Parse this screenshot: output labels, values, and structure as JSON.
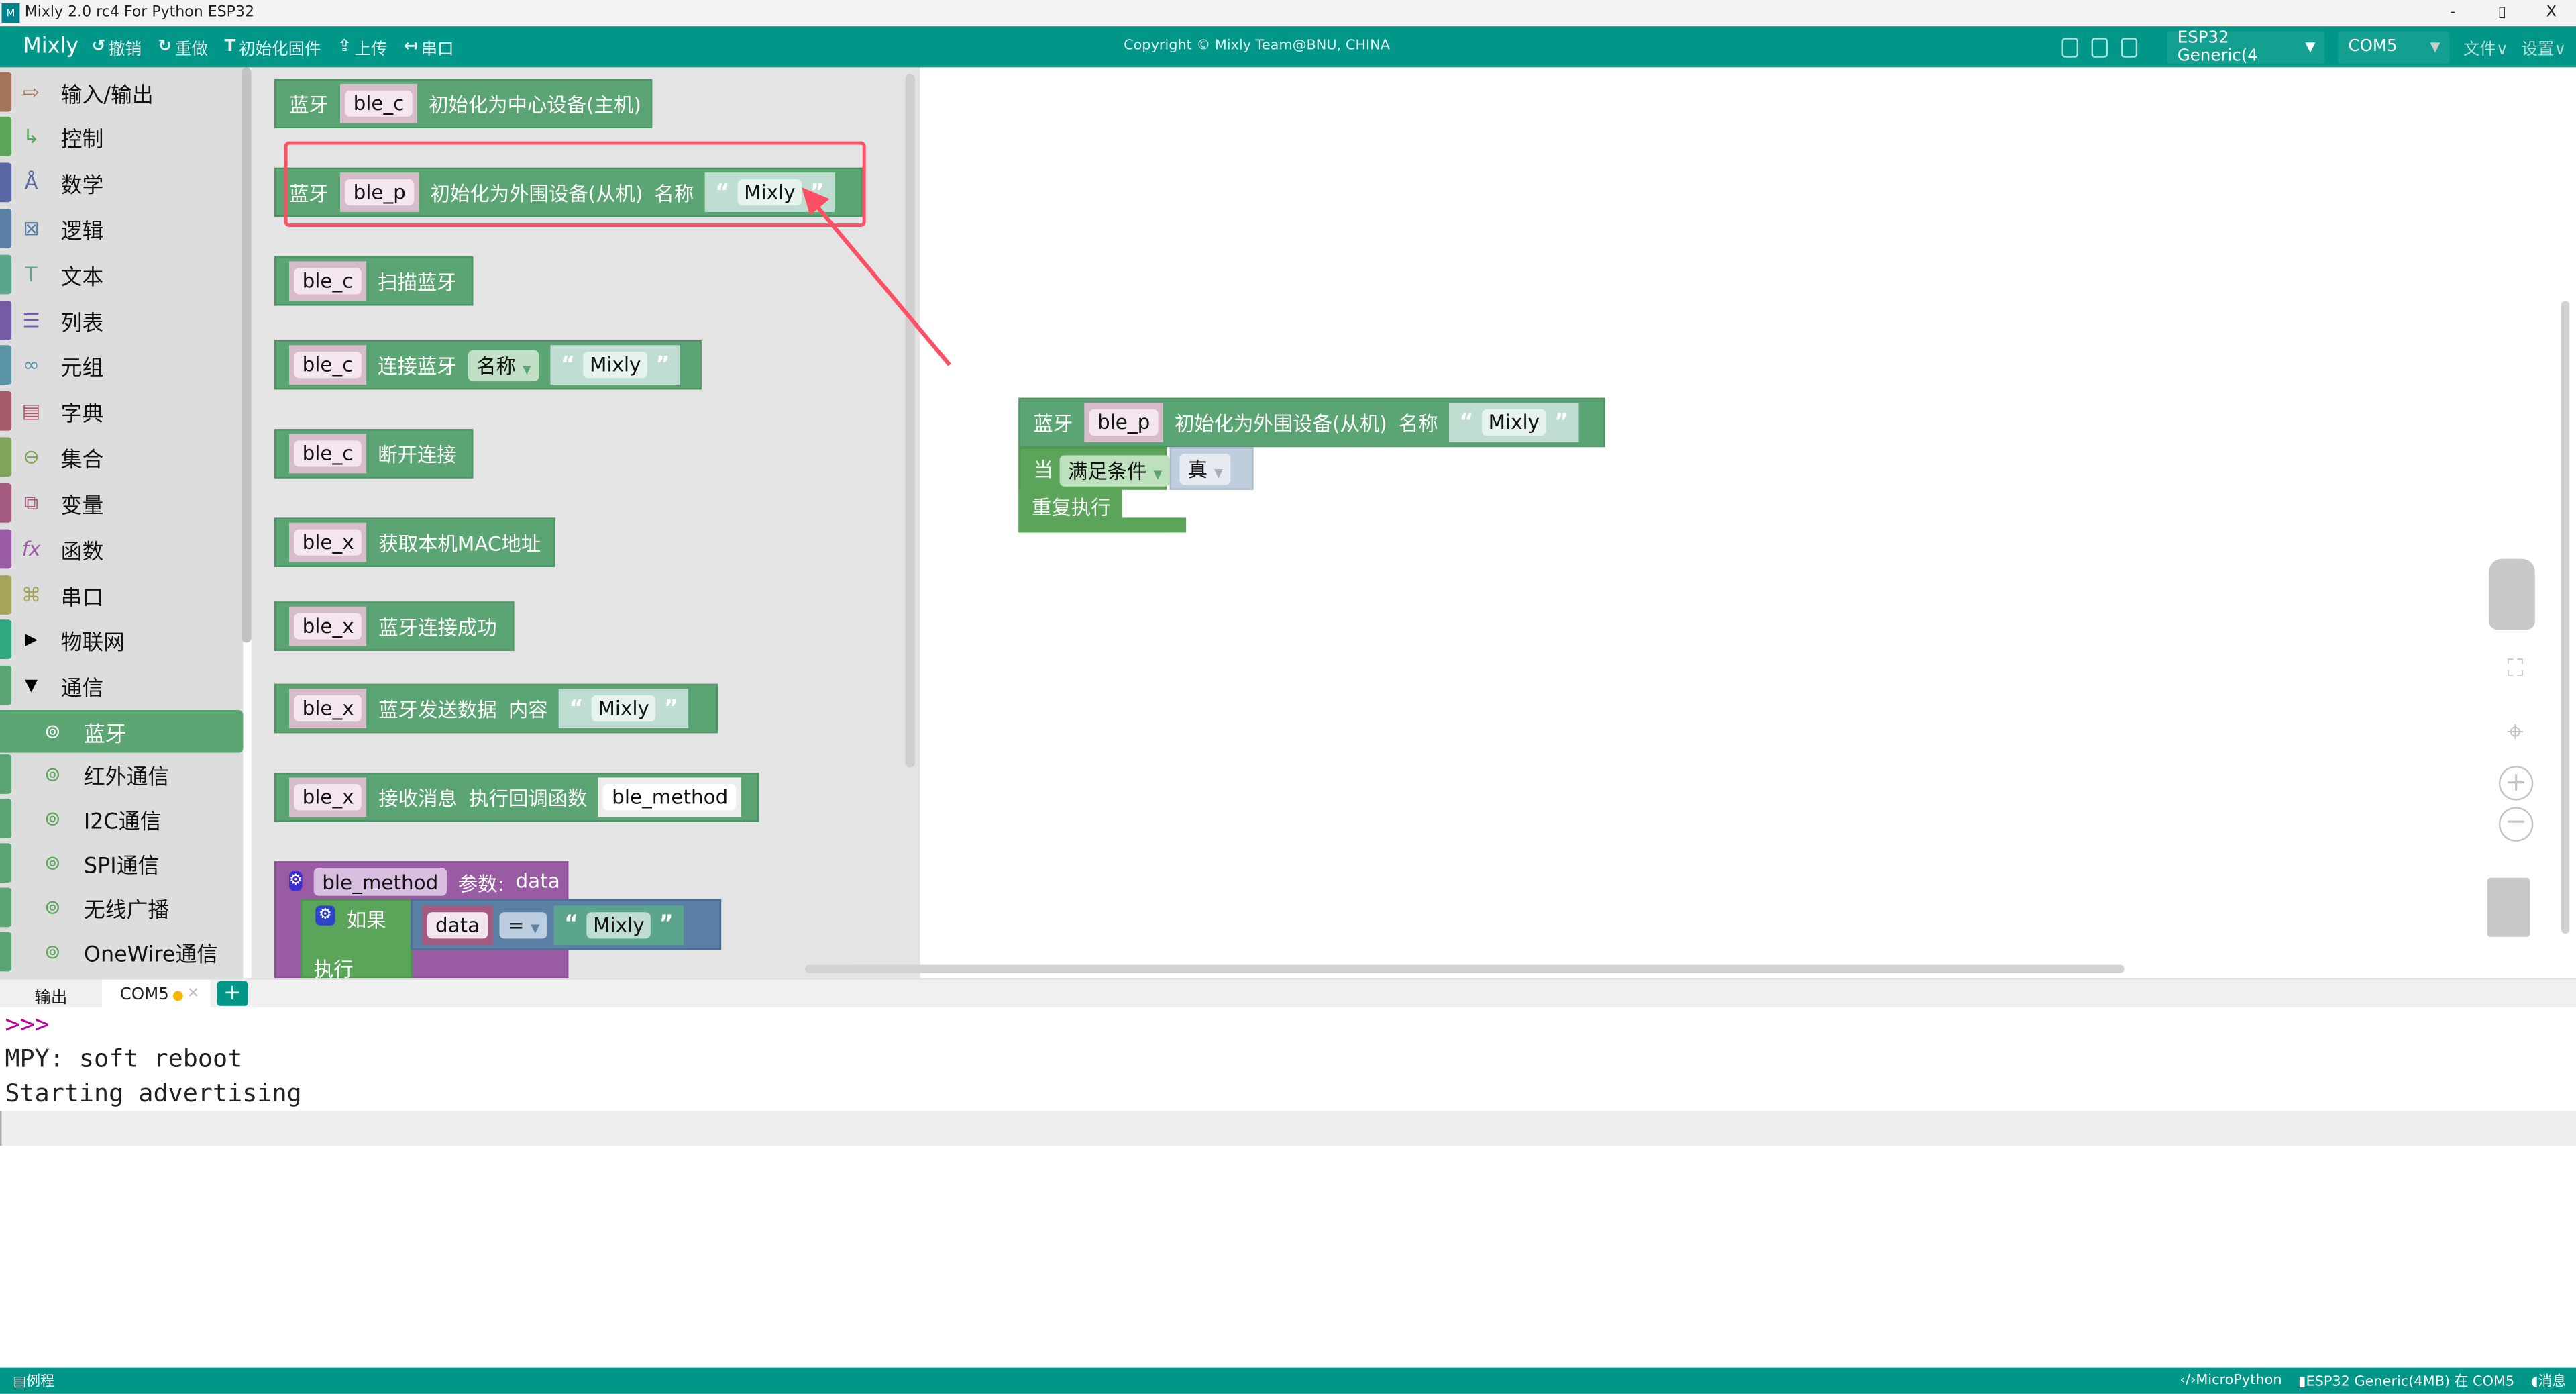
{
  "window": {
    "title": "Mixly 2.0 rc4 For Python ESP32",
    "logo": "Mixly",
    "minimize": "-",
    "maximize": "▯",
    "close": "X"
  },
  "menubar": {
    "brand": "Mixly",
    "undo": "撤销",
    "redo": "重做",
    "init_firmware": "初始化固件",
    "upload": "上传",
    "serial": "串口",
    "copyright": "Copyright © Mixly Team@BNU, CHINA",
    "board": "ESP32 Generic(4",
    "port": "COM5",
    "file": "文件",
    "settings": "设置"
  },
  "sidebar": {
    "items": [
      {
        "label": "输入/输出",
        "color": "#a5745b",
        "icon": "io-icon"
      },
      {
        "label": "控制",
        "color": "#5ba55b",
        "icon": "control-icon"
      },
      {
        "label": "数学",
        "color": "#5b67a5",
        "icon": "math-icon"
      },
      {
        "label": "逻辑",
        "color": "#5b80a5",
        "icon": "logic-icon"
      },
      {
        "label": "文本",
        "color": "#5ba58c",
        "icon": "text-icon"
      },
      {
        "label": "列表",
        "color": "#745ba5",
        "icon": "list-icon"
      },
      {
        "label": "元组",
        "color": "#5b95a5",
        "icon": "tuple-icon"
      },
      {
        "label": "字典",
        "color": "#a55b6a",
        "icon": "dict-icon"
      },
      {
        "label": "集合",
        "color": "#80a55b",
        "icon": "set-icon"
      },
      {
        "label": "变量",
        "color": "#a55b80",
        "icon": "variable-icon"
      },
      {
        "label": "函数",
        "color": "#995ba5",
        "icon": "function-icon"
      },
      {
        "label": "串口",
        "color": "#a5a55b",
        "icon": "serial-icon"
      },
      {
        "label": "物联网",
        "color": "#2fa982",
        "icon": "expand-icon"
      },
      {
        "label": "通信",
        "color": "#5ba574",
        "icon": "collapse-icon"
      }
    ],
    "sub_items": [
      {
        "label": "蓝牙"
      },
      {
        "label": "红外通信"
      },
      {
        "label": "I2C通信"
      },
      {
        "label": "SPI通信"
      },
      {
        "label": "无线广播"
      },
      {
        "label": "OneWire通信"
      }
    ]
  },
  "flyout": {
    "b1": {
      "head": "蓝牙",
      "var": "ble_c",
      "text": "初始化为中心设备(主机)"
    },
    "b2": {
      "head": "蓝牙",
      "var": "ble_p",
      "text": "初始化为外围设备(从机)",
      "name_label": "名称",
      "value": "Mixly"
    },
    "b3": {
      "var": "ble_c",
      "text": "扫描蓝牙"
    },
    "b4": {
      "var": "ble_c",
      "text": "连接蓝牙",
      "dropdown": "名称",
      "value": "Mixly"
    },
    "b5": {
      "var": "ble_c",
      "text": "断开连接"
    },
    "b6": {
      "var": "ble_x",
      "text": "获取本机MAC地址"
    },
    "b7": {
      "var": "ble_x",
      "text": "蓝牙连接成功"
    },
    "b8": {
      "var": "ble_x",
      "text": "蓝牙发送数据",
      "content_label": "内容",
      "value": "Mixly"
    },
    "b9": {
      "var": "ble_x",
      "text": "接收消息",
      "callback_label": "执行回调函数",
      "callback": "ble_method"
    },
    "b10": {
      "name": "ble_method",
      "params": "参数:",
      "param": "data",
      "if": "如果",
      "cmp_var": "data",
      "op": "=",
      "value": "Mixly",
      "do": "执行"
    }
  },
  "workspace": {
    "head": "蓝牙",
    "var": "ble_p",
    "text": "初始化为外围设备(从机)",
    "name_label": "名称",
    "value": "Mixly",
    "while": "当",
    "mode": "满足条件",
    "cond": "真",
    "repeat": "重复执行"
  },
  "panel": {
    "tab_output": "输出",
    "tab_com": "COM5",
    "add": "+",
    "prompt": ">>>",
    "lines": [
      "MPY: soft reboot",
      "Starting advertising"
    ]
  },
  "status": {
    "left": "例程",
    "lang": "MicroPython",
    "board": "ESP32 Generic(4MB) 在 COM5",
    "msg": "消息"
  },
  "colors": {
    "primary": "#009688",
    "block_green": "#5ba574",
    "highlight": "#ff4f64"
  }
}
